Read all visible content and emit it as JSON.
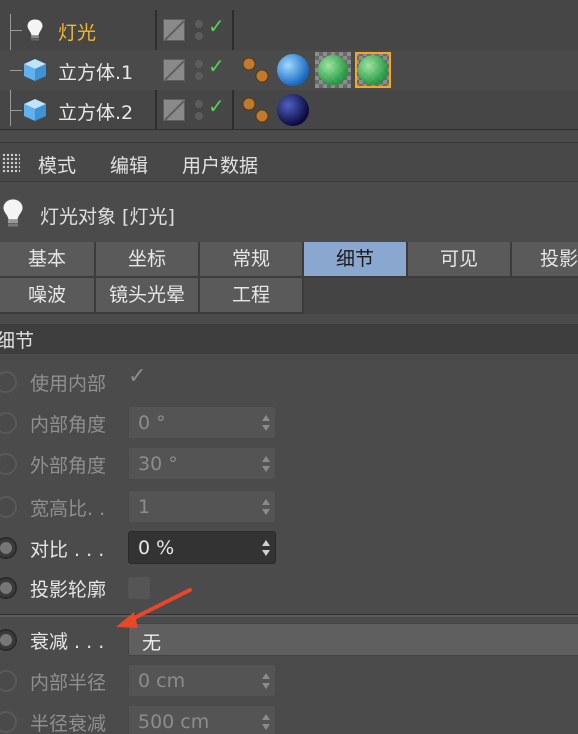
{
  "objects": [
    {
      "name": "灯光",
      "icon": "lightbulb-icon",
      "active": true
    },
    {
      "name": "立方体.1",
      "icon": "cube-icon",
      "active": false
    },
    {
      "name": "立方体.2",
      "icon": "cube-icon",
      "active": false
    }
  ],
  "menu": {
    "items": [
      "模式",
      "编辑",
      "用户数据"
    ]
  },
  "header": {
    "title": "灯光对象 [灯光]"
  },
  "tabs": {
    "row1": [
      "基本",
      "坐标",
      "常规",
      "细节",
      "可见",
      "投影"
    ],
    "row2": [
      "噪波",
      "镜头光晕",
      "工程"
    ],
    "selected": "细节"
  },
  "section": {
    "title": "细节"
  },
  "properties": {
    "use_inner": {
      "label": "使用内部"
    },
    "inner_angle": {
      "label": "内部角度",
      "value": "0 °"
    },
    "outer_angle": {
      "label": "外部角度",
      "value": "30 °"
    },
    "aspect": {
      "label": "宽高比. .",
      "value": "1"
    },
    "contrast": {
      "label": "对比  . . .",
      "value": "0 %"
    },
    "shadow_caster": {
      "label": "投影轮廓"
    },
    "falloff": {
      "label": "衰减  . . .",
      "value": "无"
    },
    "inner_radius": {
      "label": "内部半径",
      "value": "0 cm"
    },
    "radius_decay": {
      "label": "半径衰减",
      "value": "500 cm"
    }
  },
  "colors": {
    "accent_tab": "#8aa8cf",
    "active_object": "#f2b733",
    "check": "#52d35a",
    "annotation_arrow": "#e8472a"
  }
}
